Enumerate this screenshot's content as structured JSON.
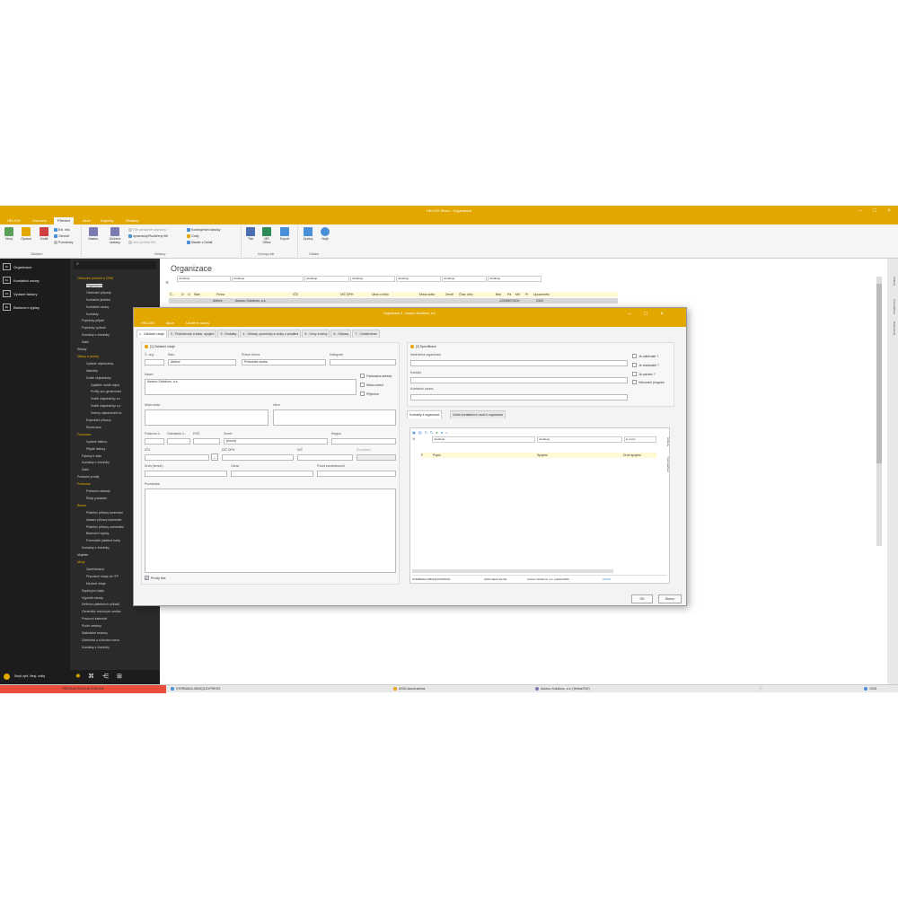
{
  "app": {
    "title": "HELIOS iNuvo - Organizace"
  },
  "menu": {
    "items": [
      "HELIOS",
      "Domovní",
      "Přehled",
      "Akce",
      "Doplňky",
      "Sestavy"
    ],
    "active": 2
  },
  "ribbon": {
    "nový": "Nový",
    "oprava": "Oprava",
    "zrusit": "Zrušit",
    "ext_info": "Ext. info",
    "obnovit": "Obnovit",
    "poznamky": "Poznámky",
    "group_zakladni": "Základní",
    "nastav": "Nastav.",
    "ulozene_sestavy": "Uložené sestavy",
    "filtr_oznacene": "Filtr označené záznamy",
    "dynamicky_filtr": "dynamický/Rozšířený filtr",
    "zrusit_filtr": "Zruš prohlíží filtr",
    "kontingencni": "Kontingenční tabulky",
    "grafy": "Grafy",
    "master_detail": "Master x Detail",
    "group_sestavy": "Sestavy",
    "tisk": "Tisk",
    "ms_office": "MS Office",
    "export": "Export",
    "group_vystupy": "Výstupy dat",
    "zpravy": "Zprávy",
    "najit": "Najít",
    "group_ostatni": "Ostatní"
  },
  "leftnav": {
    "items": [
      {
        "badge": "Or",
        "label": "Organizace"
      },
      {
        "badge": "Ko",
        "label": "Kontaktní osoby"
      },
      {
        "badge": "VF",
        "label": "Vydané faktury"
      },
      {
        "badge": "Bv",
        "label": "Bankovní výpisy"
      }
    ],
    "bottom": "Skrýt vyhl. Nezj. volby"
  },
  "tree": {
    "items": [
      {
        "label": "Obchodní partneři a CRM",
        "cat": true,
        "indent": 0
      },
      {
        "label": "Organizace",
        "sel": true,
        "indent": 2
      },
      {
        "label": "Obchodní případy",
        "indent": 2
      },
      {
        "label": "Kontaktní jednání",
        "indent": 2
      },
      {
        "label": "Kontaktní osoby",
        "indent": 2
      },
      {
        "label": "Kontakty",
        "indent": 2
      },
      {
        "label": "Poptávky přijaté",
        "indent": 1
      },
      {
        "label": "Poptávky vydané",
        "indent": 1
      },
      {
        "label": "Kontakty z číselníky",
        "indent": 1
      },
      {
        "label": "Další",
        "indent": 1
      },
      {
        "label": "Sklady",
        "indent": 0
      },
      {
        "label": "Nákup a prodej",
        "cat": true,
        "indent": 0
      },
      {
        "label": "Vydané objednávky",
        "indent": 2
      },
      {
        "label": "Nabídky",
        "indent": 2
      },
      {
        "label": "Došlé objednávky",
        "indent": 2
      },
      {
        "label": "Zajištění došlé objed",
        "indent": 3
      },
      {
        "label": "Profily pro generováni",
        "indent": 3
      },
      {
        "label": "Došlé objednávky a c",
        "indent": 3
      },
      {
        "label": "Došlé objednávky s p",
        "indent": 3
      },
      {
        "label": "Změny objednávek ho",
        "indent": 3
      },
      {
        "label": "Expediční příkazy",
        "indent": 2
      },
      {
        "label": "Rezervace",
        "indent": 2
      },
      {
        "label": "Fakturace",
        "cat": true,
        "indent": 0
      },
      {
        "label": "Vydané faktury",
        "indent": 2
      },
      {
        "label": "Přijaté faktury",
        "indent": 2
      },
      {
        "label": "Faktury k datu",
        "indent": 1
      },
      {
        "label": "Kontakty z číselníky",
        "indent": 1
      },
      {
        "label": "Další",
        "indent": 1
      },
      {
        "label": "Pokladní prodej",
        "indent": 0
      },
      {
        "label": "Pokladna",
        "cat": true,
        "indent": 0
      },
      {
        "label": "Pokladní doklady",
        "indent": 2
      },
      {
        "label": "Řady pokladen",
        "indent": 2
      },
      {
        "label": "Banka",
        "cat": true,
        "indent": 0
      },
      {
        "label": "Platební příkazy tuzemské",
        "indent": 2
      },
      {
        "label": "Inkasní příkazy tuzemské",
        "indent": 2
      },
      {
        "label": "Platební příkazy zahraniční",
        "indent": 2
      },
      {
        "label": "Bankovní výpisy",
        "indent": 2
      },
      {
        "label": "Formuláře platební karty",
        "indent": 2
      },
      {
        "label": "Kontakty z číselníky",
        "indent": 1
      },
      {
        "label": "Majetek",
        "indent": 0
      },
      {
        "label": "Mzdy",
        "cat": true,
        "indent": 0
      },
      {
        "label": "Zaměstnanci",
        "indent": 2
      },
      {
        "label": "Přípravné údaje do ITP",
        "indent": 2
      },
      {
        "label": "Mzdové údaje",
        "indent": 2
      },
      {
        "label": "Doplňující údaje",
        "indent": 1
      },
      {
        "label": "Výpočet mezdy",
        "indent": 1
      },
      {
        "label": "Definice platebních příkazů",
        "indent": 1
      },
      {
        "label": "Generátor mzdových sestav",
        "indent": 1
      },
      {
        "label": "Pracovní kalendář",
        "indent": 1
      },
      {
        "label": "Roční sestavy",
        "indent": 1
      },
      {
        "label": "Statistické sestavy",
        "indent": 1
      },
      {
        "label": "Účetnictví a účtování mezd",
        "indent": 1
      },
      {
        "label": "Kontakty z číselníky",
        "indent": 1
      }
    ]
  },
  "main": {
    "heading": "Organizace",
    "filters": [
      "obsahuje",
      "obsahuje",
      "obsahuje",
      "obsahuje",
      "obsahuje",
      "obsahuje",
      "obsahuje"
    ],
    "columns": [
      "Č...",
      "O",
      "O",
      "Stav",
      "Firma",
      "IČO",
      "DIČ DPH",
      "Ulice a číslo",
      "Místo sídla",
      "Země",
      "Číslo účtu",
      "Bnk",
      "Pa",
      "MV",
      "Pr",
      "Upozornění"
    ],
    "row": [
      "Aktivní",
      "Asseco Solutions, a.s.",
      "",
      "",
      "",
      "",
      "",
      "1234567/0100",
      "0300"
    ]
  },
  "sidebar": {
    "tabs": [
      "Atributy",
      "Formulářové",
      "Dokumenty"
    ]
  },
  "statusbar": {
    "red": "PŘEDNASTAVENÁ ČERVEŇ",
    "server": "STERBADA-NB\\SQLEXPRESS",
    "user": "ASOL\\david.sterba",
    "company": "Asseco Solutions, a.s. (Helios/S00)",
    "count": "1/001"
  },
  "dialog": {
    "title": "Organizace 3 - Asseco Solutions, a.s.",
    "menu": [
      "HELIOS",
      "Akce",
      "Uložené názvy"
    ],
    "tabs": [
      "1 - Základní údaje",
      "2 - Podrobnosti a bank. spojení",
      "3 - Dodatky",
      "4 - Úhrady, upomínky a úroky z prodlení",
      "5 - Ceny a slevy",
      "6 - Odkazy",
      "7 - Credtechnet"
    ],
    "section1": "[1] Základní údaje",
    "section2": "[2] Specifikace",
    "cislo_label": "Č. org:",
    "stav_label": "Stav:",
    "stav_value": "Aktivní",
    "pravni_forma_label": "Právní forma",
    "pravni_forma_value": "Právnická osoba",
    "kategorie_label": "Kategorie",
    "nazev_label": "Název",
    "nazev_value": "Asseco Solutions, a.s.",
    "fakturacni": "Fakturační adresa",
    "misto_urceni": "Místo určení",
    "prijemce": "Příjemce",
    "misto_sidla_label": "Místo sídla",
    "ulice_label": "Ulice",
    "psc_label": "Poštovní č.:",
    "orient_label": "Orientační č.:",
    "psc2_label": "PSČ:",
    "zeme_label": "Země:",
    "zeme_value": "(enum)",
    "region_label": "Region",
    "ico_label": "IČO",
    "dic_label": "DIČ DPH",
    "dic2_label": "DIČ",
    "dic_poslani": "ID poslání",
    "druh_label": "Druh (firmně)",
    "obrat_label": "Obrat",
    "pocet_label": "Počet zaměstnanců",
    "poznamka_label": "Poznámka",
    "prosty_text": "Prostý text",
    "nadrizena_label": "Nadřízená organizace",
    "kontakt_label": "Kontakt",
    "kontaktni_osoba_label": "Kontaktní osoba",
    "je_odberatel": "Je odběratel ?",
    "je_dodavatel": "Je dodavatel ?",
    "je_partner": "Je partner ?",
    "vernostni": "Věrnostní program",
    "sub_tabs": [
      "Kontakty k organizaci",
      "Vztah kontaktních osob k organizaci"
    ],
    "sub_filters": [
      "obsahuje",
      "obsahuje",
      "je rovno"
    ],
    "sub_cols": [
      "Popis",
      "Spojení",
      "Druh spojení"
    ],
    "sub_side": [
      "Atributy",
      "Formulářové"
    ],
    "sub_status": {
      "server": "STERBADA-NB\\SQLEXPRESS",
      "user": "ASOL\\david.sterba",
      "company": "Asseco Solutions, a.s. (Helios/S00)",
      "count": "0/0000"
    },
    "ok": "OK",
    "storno": "Storno"
  }
}
